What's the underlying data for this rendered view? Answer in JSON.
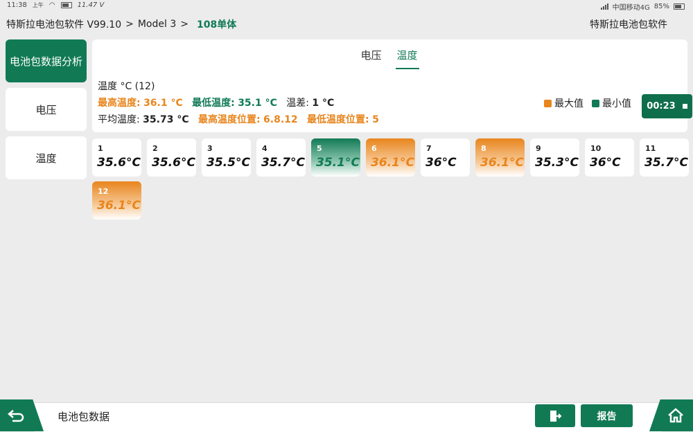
{
  "status_bar": {
    "time": "11:38",
    "ampm": "上午",
    "extra": "11.47 V",
    "carrier": "中国移动4G",
    "battery": "85%"
  },
  "header": {
    "app_version": "特斯拉电池包软件 V99.10",
    "model": "Model 3",
    "current": "108单体",
    "app_name": "特斯拉电池包软件"
  },
  "sidebar": {
    "items": [
      {
        "label": "电池包数据分析",
        "active": true
      },
      {
        "label": "电压",
        "active": false
      },
      {
        "label": "温度",
        "active": false
      }
    ]
  },
  "tabs": [
    {
      "label": "电压",
      "active": false
    },
    {
      "label": "温度",
      "active": true
    }
  ],
  "summary": {
    "title": "温度 °C (12)",
    "max_label": "最高温度:",
    "max_value": "36.1 °C",
    "min_label": "最低温度:",
    "min_value": "35.1 °C",
    "diff_label": "温差:",
    "diff_value": "1 °C",
    "avg_label": "平均温度:",
    "avg_value": "35.73 °C",
    "max_pos_label": "最高温度位置:",
    "max_pos_value": "6.8.12",
    "min_pos_label": "最低温度位置:",
    "min_pos_value": "5"
  },
  "legend": {
    "max_label": "最大值",
    "min_label": "最小值",
    "max_color": "#e8851d",
    "min_color": "#117a55"
  },
  "timer": {
    "value": "00:23"
  },
  "cells": [
    {
      "num": "1",
      "value": "35.6°C",
      "state": "normal"
    },
    {
      "num": "2",
      "value": "35.6°C",
      "state": "normal"
    },
    {
      "num": "3",
      "value": "35.5°C",
      "state": "normal"
    },
    {
      "num": "4",
      "value": "35.7°C",
      "state": "normal"
    },
    {
      "num": "5",
      "value": "35.1°C",
      "state": "min"
    },
    {
      "num": "6",
      "value": "36.1°C",
      "state": "max"
    },
    {
      "num": "7",
      "value": "36°C",
      "state": "normal"
    },
    {
      "num": "8",
      "value": "36.1°C",
      "state": "max"
    },
    {
      "num": "9",
      "value": "35.3°C",
      "state": "normal"
    },
    {
      "num": "10",
      "value": "36°C",
      "state": "normal"
    },
    {
      "num": "11",
      "value": "35.7°C",
      "state": "normal"
    },
    {
      "num": "12",
      "value": "36.1°C",
      "state": "max"
    }
  ],
  "footer": {
    "title": "电池包数据",
    "report_label": "报告"
  }
}
